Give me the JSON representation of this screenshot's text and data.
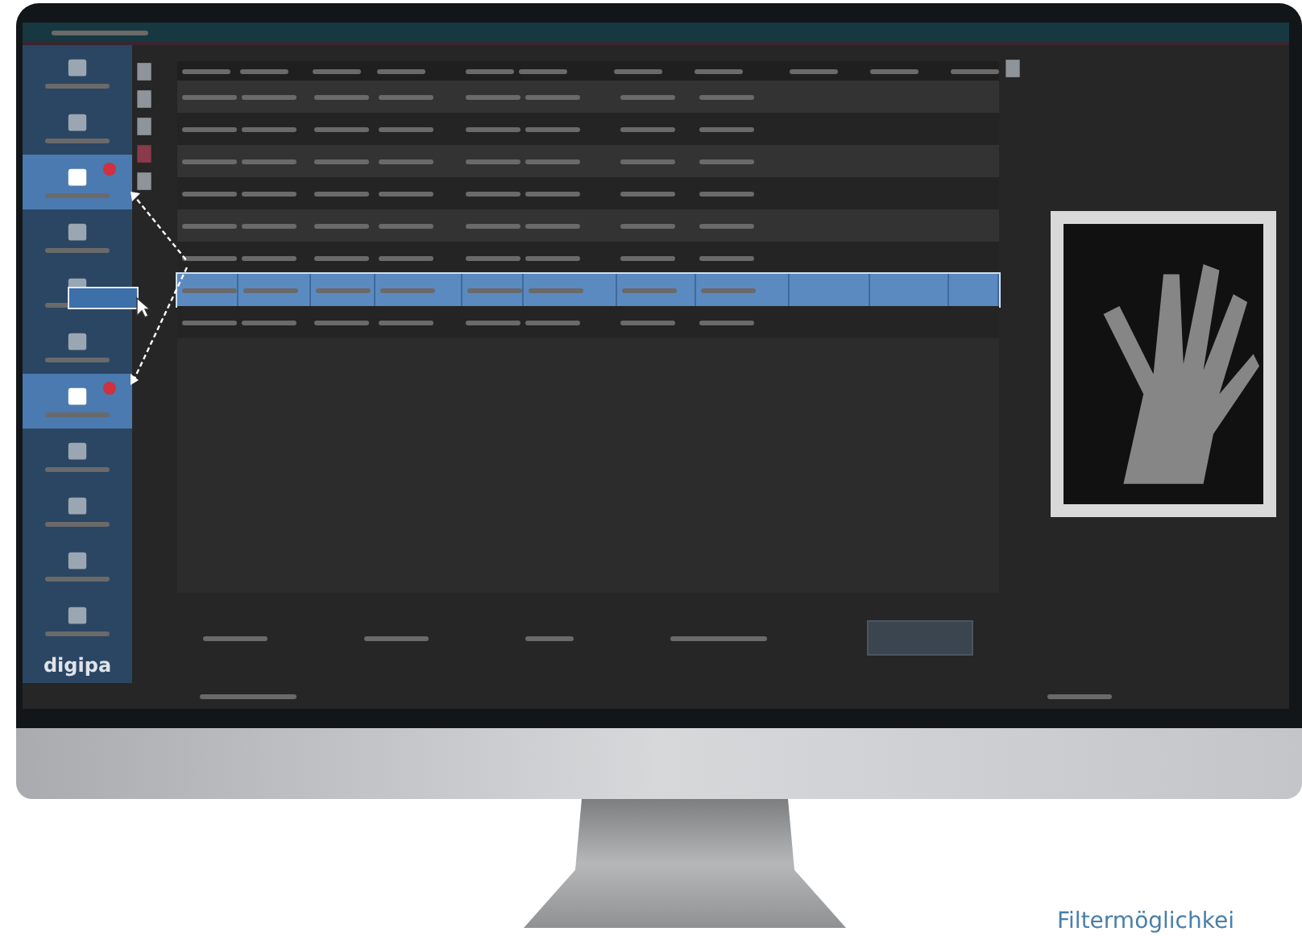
{
  "sidebar": {
    "items": [
      {
        "selected": false,
        "badge": false
      },
      {
        "selected": false,
        "badge": false
      },
      {
        "selected": true,
        "badge": true
      },
      {
        "selected": false,
        "badge": false
      },
      {
        "selected": false,
        "badge": false
      },
      {
        "selected": false,
        "badge": false
      },
      {
        "selected": true,
        "badge": true
      },
      {
        "selected": false,
        "badge": false
      },
      {
        "selected": false,
        "badge": false
      },
      {
        "selected": false,
        "badge": false
      },
      {
        "selected": false,
        "badge": false
      }
    ],
    "logo": "digipa"
  },
  "table": {
    "rows": [
      {
        "selected": false
      },
      {
        "selected": false
      },
      {
        "selected": false
      },
      {
        "selected": false
      },
      {
        "selected": false
      },
      {
        "selected": false
      },
      {
        "selected": true
      },
      {
        "selected": false
      }
    ]
  },
  "caption": "Filtermöglichkei"
}
